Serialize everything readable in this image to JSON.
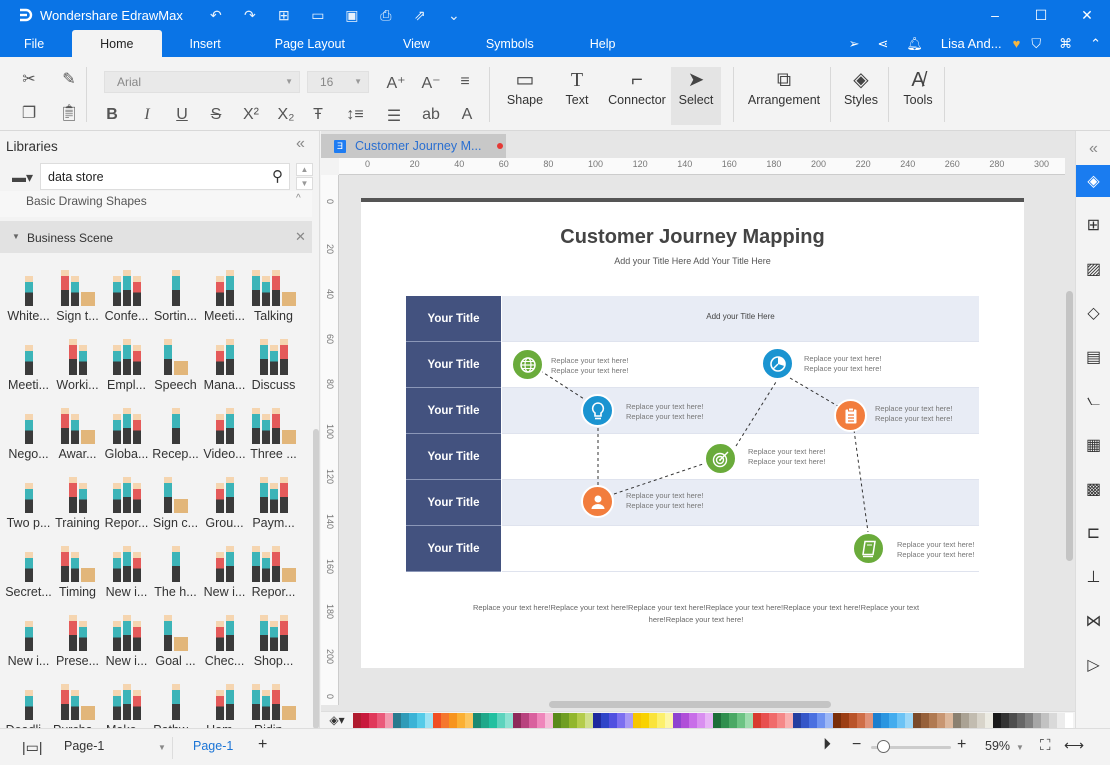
{
  "app": {
    "name": "Wondershare EdrawMax",
    "quick_access": [
      "undo-icon",
      "redo-icon",
      "new-icon",
      "open-icon",
      "save-icon",
      "print-icon",
      "export-icon",
      "customize-icon"
    ],
    "window_controls": [
      "minimize",
      "maximize",
      "close"
    ]
  },
  "menu": {
    "tabs": [
      "File",
      "Home",
      "Insert",
      "Page Layout",
      "View",
      "Symbols",
      "Help"
    ],
    "active": "Home",
    "user": "Lisa And..."
  },
  "ribbon": {
    "font": "Arial",
    "font_size": "16",
    "tools": [
      {
        "label": "Shape",
        "icon": "rectangle-icon"
      },
      {
        "label": "Text",
        "icon": "text-icon"
      },
      {
        "label": "Connector",
        "icon": "connector-icon"
      },
      {
        "label": "Select",
        "icon": "cursor-icon"
      },
      {
        "label": "Arrangement",
        "icon": "arrangement-icon"
      },
      {
        "label": "Styles",
        "icon": "paint-bucket-icon"
      },
      {
        "label": "Tools",
        "icon": "spellcheck-icon"
      }
    ]
  },
  "libraries": {
    "title": "Libraries",
    "search_value": "data store",
    "sections": [
      {
        "name": "Basic Drawing Shapes"
      },
      {
        "name": "Business Scene"
      }
    ],
    "items": [
      "White...",
      "Sign t...",
      "Confe...",
      "Sortin...",
      "Meeti...",
      "Talking",
      "Meeti...",
      "Worki...",
      "Empl...",
      "Speech",
      "Mana...",
      "Discuss",
      "Nego...",
      "Awar...",
      "Globa...",
      "Recep...",
      "Video...",
      "Three ...",
      "Two p...",
      "Training",
      "Repor...",
      "Sign c...",
      "Grou...",
      "Paym...",
      "Secret...",
      "Timing",
      "New i...",
      "The h...",
      "New i...",
      "Repor...",
      "New i...",
      "Prese...",
      "New i...",
      "Goal ...",
      "Chec...",
      "Shop...",
      "Deadli...",
      "Purcha...",
      "Make...",
      "Pathw...",
      "Hom...",
      "Ridin..."
    ]
  },
  "document": {
    "tab_name": "Customer Journey M...",
    "unsaved": true,
    "ruler_h": [
      "0",
      "20",
      "40",
      "60",
      "80",
      "100",
      "120",
      "140",
      "160",
      "180",
      "200",
      "220",
      "240",
      "260",
      "280",
      "300"
    ],
    "ruler_v": [
      "0",
      "20",
      "40",
      "60",
      "80",
      "100",
      "120",
      "140",
      "160",
      "180",
      "200",
      "0"
    ]
  },
  "diagram": {
    "title": "Customer Journey Mapping",
    "subtitle": "Add your Title Here   Add Your Title Here",
    "header_row_text": "Add your Title Here",
    "row_titles": [
      "Your Title",
      "Your Title",
      "Your Title",
      "Your Title",
      "Your Title",
      "Your Title"
    ],
    "node_text": "Replace your text here!",
    "nodes": [
      {
        "icon": "globe-icon",
        "color": "#6aab3b",
        "row": 2
      },
      {
        "icon": "lightbulb-icon",
        "color": "#1a94d1",
        "row": 3
      },
      {
        "icon": "user-icon",
        "color": "#f27d3d",
        "row": 5
      },
      {
        "icon": "target-icon",
        "color": "#6aab3b",
        "row": 4
      },
      {
        "icon": "pie-chart-icon",
        "color": "#1a94d1",
        "row": 2
      },
      {
        "icon": "clipboard-icon",
        "color": "#f27d3d",
        "row": 3
      },
      {
        "icon": "book-icon",
        "color": "#6aab3b",
        "row": 6
      }
    ],
    "footnote": "Replace your text here!Replace your text here!Replace your text here!Replace your text here!Replace your text here!Replace your text here!Replace your text here!"
  },
  "palette": [
    "#b01b2e",
    "#c8193c",
    "#e0385a",
    "#ea5a7a",
    "#f29bb0",
    "#2a7a8e",
    "#2f9bb8",
    "#3bb3d6",
    "#55cbe8",
    "#9de3f4",
    "#f04e23",
    "#f5772d",
    "#f7941d",
    "#fbb034",
    "#fcc660",
    "#1a8a72",
    "#1fa88a",
    "#22c0a0",
    "#5dd3bd",
    "#8ee2d2",
    "#8e2a5a",
    "#b8427e",
    "#d9609e",
    "#ef86bb",
    "#f6bcd8",
    "#5a8a1a",
    "#6f9e22",
    "#92b62d",
    "#b4cc4c",
    "#d0e08c",
    "#1e2a9e",
    "#2e44c8",
    "#5050e0",
    "#7c6ff0",
    "#a999f5",
    "#f7c600",
    "#f9d200",
    "#fae33a",
    "#fcf06c",
    "#fdf7a6",
    "#8e44d0",
    "#b04fd8",
    "#c86ee8",
    "#d98ff0",
    "#e8b4f6",
    "#1e6e3a",
    "#2f8f4e",
    "#4aa864",
    "#6dc383",
    "#9fdcae",
    "#d83a2e",
    "#e84f4f",
    "#f06b6b",
    "#f58888",
    "#f9b1b1",
    "#263fa0",
    "#3556c8",
    "#4a70e0",
    "#6f93f0",
    "#9db8f6",
    "#7a2e0a",
    "#9c3e14",
    "#b9542a",
    "#cf6e48",
    "#e1937a",
    "#1d7fcf",
    "#2a95e0",
    "#43acee",
    "#6cc3f5",
    "#9dd8f8",
    "#7a4a2a",
    "#96603a",
    "#b07a52",
    "#c89672",
    "#ddb89c",
    "#8a8070",
    "#aaa294",
    "#c2bcb0",
    "#d8d4ca",
    "#ecebe3",
    "#1a1a1a",
    "#333333",
    "#4d4d4d",
    "#666666",
    "#808080",
    "#a6a6a6",
    "#c2c2c2",
    "#d9d9d9",
    "#ececec",
    "#ffffff"
  ],
  "statusbar": {
    "page_select": "Page-1",
    "page_tab": "Page-1",
    "zoom": "59%",
    "zoom_fraction": 0.15
  },
  "right_panel": {
    "icons": [
      "collapse-icon",
      "fill-icon",
      "grid-icon",
      "image-icon",
      "layers-icon",
      "page-icon",
      "chart-icon",
      "table-icon",
      "puzzle-icon",
      "timeline-icon",
      "org-chart-icon",
      "mind-map-icon",
      "presentation-icon"
    ]
  }
}
